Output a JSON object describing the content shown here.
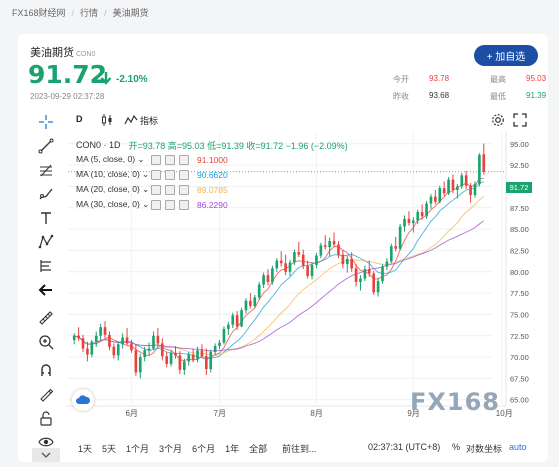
{
  "breadcrumb": {
    "site": "FX168财经网",
    "section": "行情",
    "page": "美油期货"
  },
  "header": {
    "name": "美油期货",
    "code": "CON0",
    "price": "91.72",
    "change_pct": "-2.10%",
    "timestamp": "2023-09-29 02:37:28",
    "watch_button": "+ 加自选"
  },
  "stats": {
    "open_label": "今开",
    "open": "93.78",
    "high_label": "最高",
    "high": "95.03",
    "prev_label": "昨收",
    "prev": "93.68",
    "low_label": "最低",
    "low": "91.39"
  },
  "topbar": {
    "interval": "D",
    "indicators_label": "指标"
  },
  "legend": {
    "title": "CON0 · 1D",
    "ohlc": "开=93.78  高=95.03  低=91.39  收=91.72  −1.96 (−2.09%)",
    "ma": [
      {
        "label": "MA (5, close, 0)",
        "value": "91.1000",
        "color": "#e6433c"
      },
      {
        "label": "MA (10, close, 0)",
        "value": "90.6620",
        "color": "#1ea0d6"
      },
      {
        "label": "MA (20, close, 0)",
        "value": "89.0785",
        "color": "#f0b74e"
      },
      {
        "label": "MA (30, close, 0)",
        "value": "86.2290",
        "color": "#a14bd1"
      }
    ]
  },
  "last_price_badge": "91.72",
  "watermark": "FX168",
  "bottombar": {
    "ranges": [
      "1天",
      "5天",
      "1个月",
      "3个月",
      "6个月",
      "1年",
      "全部"
    ],
    "goto": "前往到...",
    "clock": "02:37:31 (UTC+8)",
    "pct": "%",
    "log": "对数坐标",
    "auto": "auto"
  },
  "chart_data": {
    "type": "candlestick",
    "x_ticks": [
      "6月",
      "7月",
      "8月",
      "9月",
      "10月"
    ],
    "y_ticks": [
      65.0,
      67.5,
      70.0,
      72.5,
      75.0,
      77.5,
      80.0,
      82.5,
      85.0,
      87.5,
      90.0,
      92.5,
      95.0
    ],
    "ylim": [
      64.5,
      96.5
    ],
    "colors": {
      "up": "#1aa26f",
      "down": "#e6433c"
    },
    "candles": [
      [
        72.0,
        72.8,
        71.5,
        72.5
      ],
      [
        72.5,
        73.5,
        71.9,
        72.2
      ],
      [
        72.2,
        72.6,
        70.6,
        71.0
      ],
      [
        71.0,
        71.8,
        69.5,
        70.3
      ],
      [
        70.3,
        72.0,
        70.0,
        71.8
      ],
      [
        71.8,
        73.0,
        71.2,
        72.5
      ],
      [
        72.5,
        73.9,
        72.0,
        73.5
      ],
      [
        73.5,
        74.2,
        72.2,
        72.6
      ],
      [
        72.6,
        73.0,
        70.8,
        71.2
      ],
      [
        71.2,
        71.6,
        69.8,
        70.2
      ],
      [
        70.2,
        71.8,
        69.6,
        71.5
      ],
      [
        71.5,
        72.8,
        71.0,
        72.3
      ],
      [
        72.3,
        73.4,
        71.4,
        71.6
      ],
      [
        71.6,
        72.0,
        70.5,
        70.8
      ],
      [
        70.8,
        71.5,
        67.8,
        68.2
      ],
      [
        68.2,
        70.4,
        67.5,
        70.0
      ],
      [
        70.0,
        71.2,
        69.5,
        70.8
      ],
      [
        70.8,
        71.7,
        70.2,
        71.0
      ],
      [
        71.0,
        73.0,
        70.8,
        72.5
      ],
      [
        72.5,
        73.4,
        71.2,
        71.6
      ],
      [
        71.6,
        72.2,
        69.6,
        70.1
      ],
      [
        70.1,
        70.6,
        68.8,
        69.2
      ],
      [
        69.2,
        70.8,
        68.9,
        70.5
      ],
      [
        70.5,
        71.3,
        69.8,
        70.2
      ],
      [
        70.2,
        70.7,
        68.0,
        68.5
      ],
      [
        68.5,
        69.8,
        67.9,
        69.5
      ],
      [
        69.5,
        70.6,
        69.0,
        70.3
      ],
      [
        70.3,
        71.0,
        69.4,
        69.7
      ],
      [
        69.7,
        71.2,
        69.4,
        70.8
      ],
      [
        70.8,
        71.5,
        69.9,
        70.1
      ],
      [
        70.1,
        71.0,
        67.9,
        68.6
      ],
      [
        68.6,
        70.9,
        68.2,
        70.6
      ],
      [
        70.6,
        71.6,
        70.2,
        71.3
      ],
      [
        71.3,
        72.0,
        70.9,
        71.7
      ],
      [
        71.7,
        73.6,
        71.5,
        73.3
      ],
      [
        73.3,
        74.1,
        72.6,
        73.8
      ],
      [
        73.8,
        75.2,
        73.4,
        74.9
      ],
      [
        74.9,
        75.4,
        73.2,
        73.6
      ],
      [
        73.6,
        75.8,
        73.5,
        75.5
      ],
      [
        75.5,
        76.9,
        75.1,
        76.6
      ],
      [
        76.6,
        77.5,
        75.7,
        76.0
      ],
      [
        76.0,
        77.3,
        75.8,
        77.0
      ],
      [
        77.0,
        78.8,
        76.7,
        78.5
      ],
      [
        78.5,
        79.9,
        78.1,
        79.6
      ],
      [
        79.6,
        80.3,
        78.4,
        78.8
      ],
      [
        78.8,
        80.7,
        78.5,
        80.4
      ],
      [
        80.4,
        81.6,
        80.0,
        81.3
      ],
      [
        81.3,
        82.4,
        80.6,
        81.0
      ],
      [
        81.0,
        82.0,
        79.6,
        80.0
      ],
      [
        80.0,
        81.4,
        79.5,
        81.1
      ],
      [
        81.1,
        82.6,
        80.8,
        82.3
      ],
      [
        82.3,
        83.5,
        81.7,
        82.0
      ],
      [
        82.0,
        82.6,
        80.3,
        80.7
      ],
      [
        80.7,
        81.3,
        79.2,
        79.5
      ],
      [
        79.5,
        81.1,
        79.1,
        80.8
      ],
      [
        80.8,
        82.2,
        80.4,
        81.9
      ],
      [
        81.9,
        83.4,
        81.6,
        83.1
      ],
      [
        83.1,
        84.3,
        82.6,
        82.9
      ],
      [
        82.9,
        84.0,
        81.8,
        83.6
      ],
      [
        83.6,
        84.6,
        82.9,
        83.2
      ],
      [
        83.2,
        83.6,
        81.6,
        82.0
      ],
      [
        82.0,
        82.6,
        80.4,
        80.9
      ],
      [
        80.9,
        81.9,
        79.9,
        81.5
      ],
      [
        81.5,
        82.3,
        80.0,
        80.4
      ],
      [
        80.4,
        80.9,
        78.3,
        78.8
      ],
      [
        78.8,
        79.6,
        77.8,
        79.2
      ],
      [
        79.2,
        80.7,
        78.9,
        80.3
      ],
      [
        80.3,
        81.3,
        79.4,
        79.8
      ],
      [
        79.8,
        80.1,
        77.3,
        77.6
      ],
      [
        77.6,
        79.3,
        77.1,
        78.9
      ],
      [
        78.9,
        80.9,
        78.6,
        80.6
      ],
      [
        80.6,
        81.6,
        80.2,
        81.2
      ],
      [
        81.2,
        83.3,
        81.0,
        83.0
      ],
      [
        83.0,
        84.1,
        82.4,
        82.7
      ],
      [
        82.7,
        85.6,
        82.5,
        85.3
      ],
      [
        85.3,
        86.6,
        84.7,
        86.2
      ],
      [
        86.2,
        87.1,
        85.4,
        85.7
      ],
      [
        85.7,
        86.4,
        84.6,
        86.0
      ],
      [
        86.0,
        87.3,
        85.6,
        87.0
      ],
      [
        87.0,
        87.9,
        86.1,
        86.5
      ],
      [
        86.5,
        88.3,
        86.2,
        88.0
      ],
      [
        88.0,
        89.1,
        87.4,
        88.8
      ],
      [
        88.8,
        89.6,
        87.9,
        88.2
      ],
      [
        88.2,
        90.1,
        88.0,
        89.8
      ],
      [
        89.8,
        90.6,
        88.9,
        89.2
      ],
      [
        89.2,
        91.1,
        89.0,
        90.8
      ],
      [
        90.8,
        91.4,
        89.2,
        89.6
      ],
      [
        89.6,
        90.3,
        88.6,
        90.0
      ],
      [
        90.0,
        91.6,
        89.7,
        91.3
      ],
      [
        91.3,
        91.8,
        89.7,
        90.1
      ],
      [
        90.1,
        90.4,
        88.1,
        89.0
      ],
      [
        89.0,
        90.6,
        88.7,
        90.3
      ],
      [
        90.3,
        93.9,
        90.0,
        93.7
      ],
      [
        93.78,
        95.03,
        91.39,
        91.72
      ]
    ],
    "ma5_last": 91.1,
    "ma10_last": 90.662,
    "ma20_last": 89.0785,
    "ma30_last": 86.229
  }
}
